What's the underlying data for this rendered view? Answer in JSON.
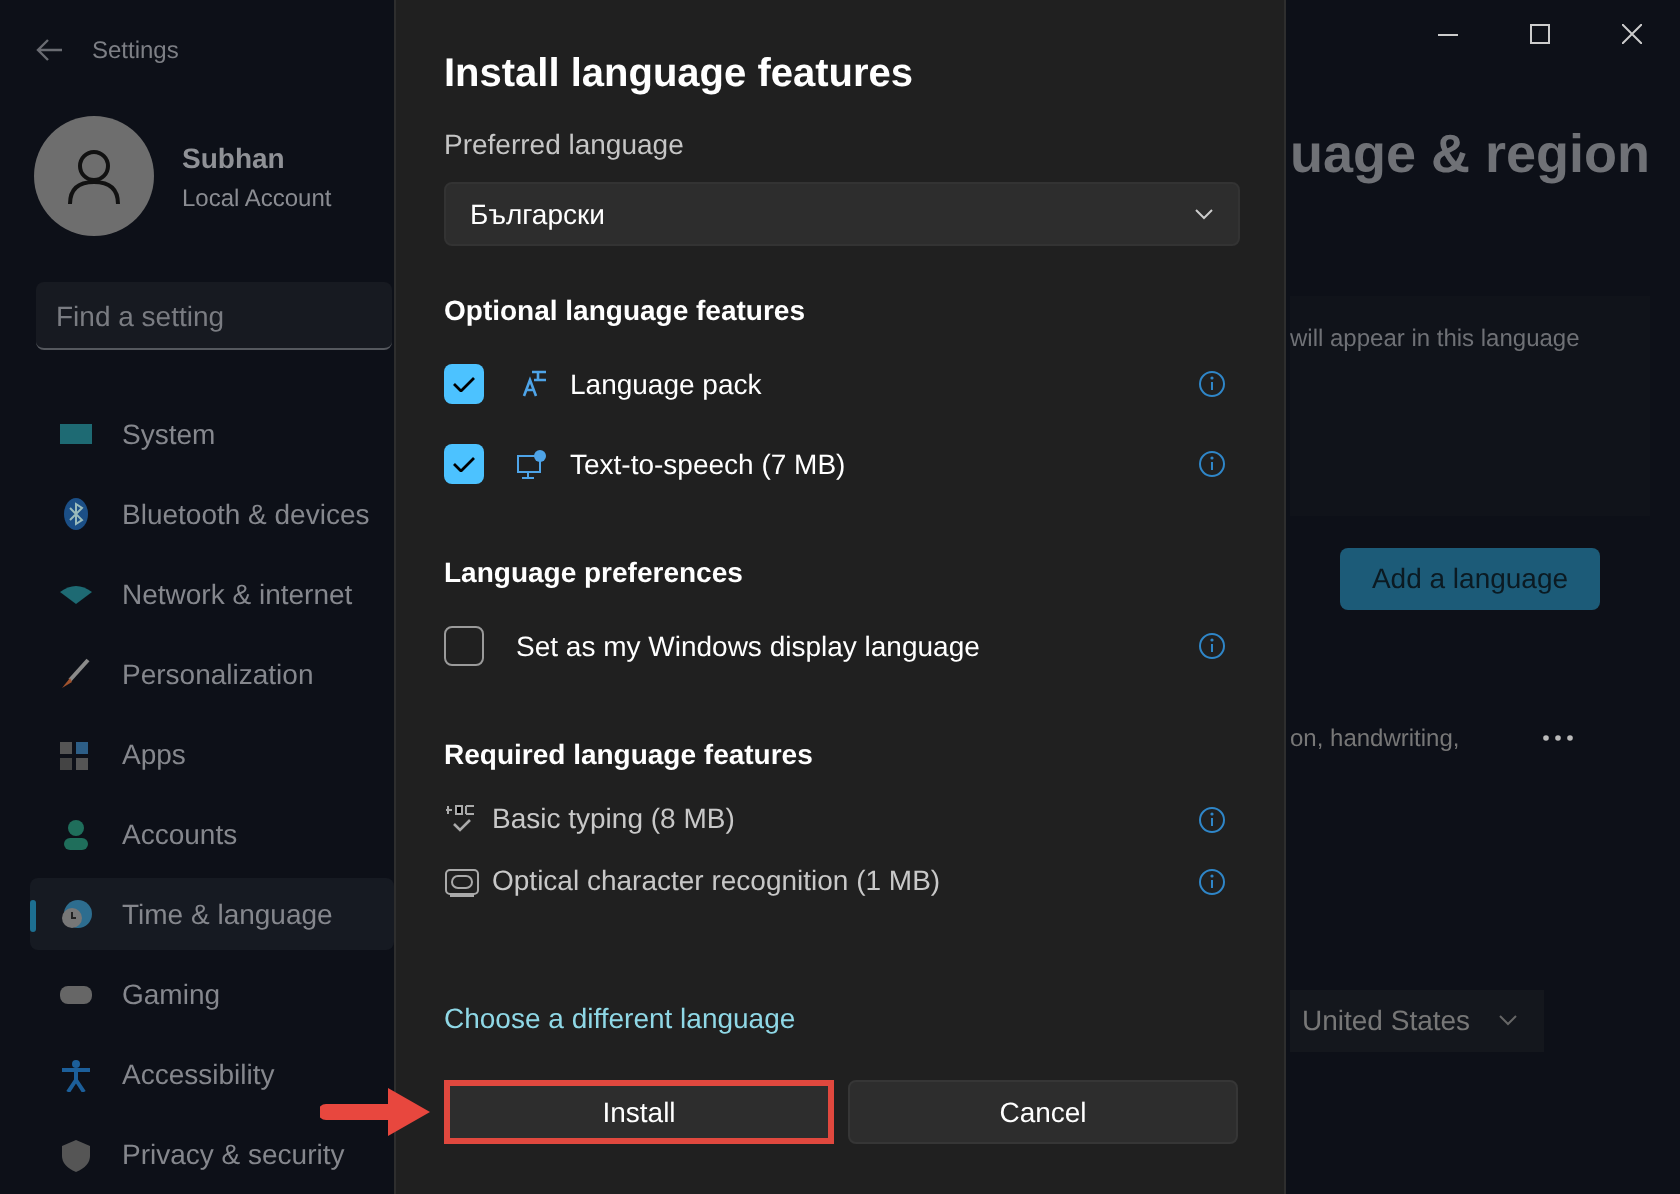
{
  "window": {
    "title": "Settings"
  },
  "account": {
    "name": "Subhan",
    "type": "Local Account"
  },
  "search": {
    "placeholder": "Find a setting"
  },
  "sidebar": {
    "items": [
      {
        "label": "System",
        "selected": false
      },
      {
        "label": "Bluetooth & devices",
        "selected": false
      },
      {
        "label": "Network & internet",
        "selected": false
      },
      {
        "label": "Personalization",
        "selected": false
      },
      {
        "label": "Apps",
        "selected": false
      },
      {
        "label": "Accounts",
        "selected": false
      },
      {
        "label": "Time & language",
        "selected": true
      },
      {
        "label": "Gaming",
        "selected": false
      },
      {
        "label": "Accessibility",
        "selected": false
      },
      {
        "label": "Privacy & security",
        "selected": false
      }
    ]
  },
  "page": {
    "title": "uage & region",
    "display_note": "will appear in this language",
    "add_button": "Add a language",
    "language_note": "on, handwriting,",
    "region_value": "United States"
  },
  "dialog": {
    "title": "Install language features",
    "preferred_label": "Preferred language",
    "language": "Български",
    "sections": [
      {
        "heading": "Optional language features",
        "items": [
          {
            "kind": "feature-check",
            "label": "Language pack",
            "checked": true
          },
          {
            "kind": "feature-check",
            "label": "Text-to-speech (7 MB)",
            "checked": true
          }
        ]
      },
      {
        "heading": "Language preferences",
        "items": [
          {
            "kind": "check",
            "label": "Set as my Windows display language",
            "checked": false
          }
        ]
      },
      {
        "heading": "Required language features",
        "items": [
          {
            "kind": "feature",
            "label": "Basic typing (8 MB)"
          },
          {
            "kind": "feature",
            "label": "Optical character recognition (1 MB)"
          }
        ]
      }
    ],
    "link": "Choose a different language",
    "buttons": [
      {
        "label": "Install",
        "highlighted": true
      },
      {
        "label": "Cancel",
        "highlighted": false
      }
    ]
  }
}
